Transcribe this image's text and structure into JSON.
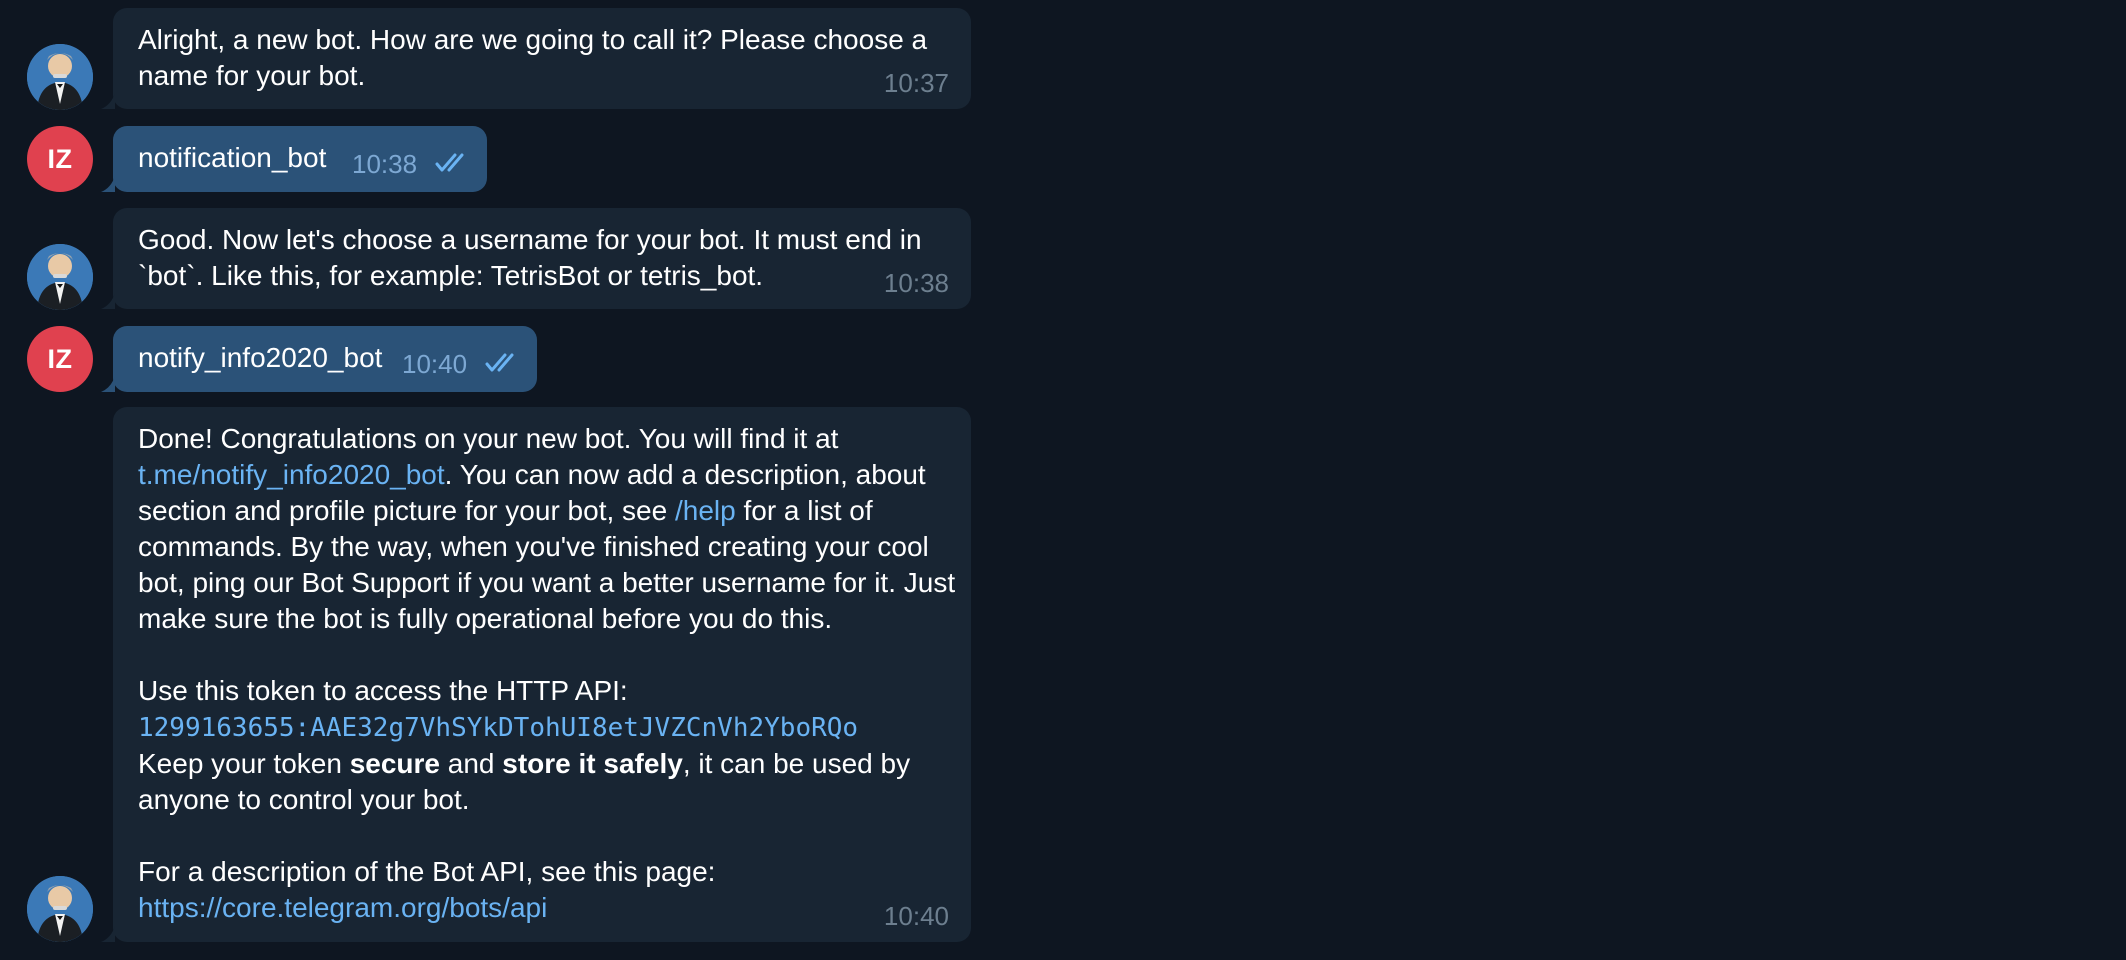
{
  "colors": {
    "background": "#0e1621",
    "incoming_bubble": "#182533",
    "outgoing_bubble": "#2b5278",
    "link": "#6ab3f3",
    "time": "#6d7f8f",
    "avatar_iz": "#e0414f"
  },
  "user": {
    "initials": "IZ"
  },
  "messages": [
    {
      "sender": "bot",
      "lines": [
        "Alright, a new bot. How are we going to call it? Please choose a",
        "name for your bot."
      ],
      "time": "10:37"
    },
    {
      "sender": "user",
      "text": "notification_bot",
      "time": "10:38",
      "read": true
    },
    {
      "sender": "bot",
      "lines": [
        "Good. Now let's choose a username for your bot. It must end in",
        "`bot`. Like this, for example: TetrisBot or tetris_bot."
      ],
      "time": "10:38"
    },
    {
      "sender": "user",
      "text": "notify_info2020_bot",
      "time": "10:40",
      "read": true
    },
    {
      "sender": "bot",
      "time": "10:40",
      "p1": {
        "l1": "Done! Congratulations on your new bot. You will find it at",
        "link1": "t.me/notify_info2020_bot",
        "l2_rest": ". You can now add a description, about",
        "l3_a": "section and profile picture for your bot, see ",
        "link2": "/help",
        "l3_b": " for a list of",
        "l4": "commands. By the way, when you've finished creating your cool",
        "l5": "bot, ping our Bot Support if you want a better username for it. Just",
        "l6": "make sure the bot is fully operational before you do this."
      },
      "p2": {
        "l1": "Use this token to access the HTTP API:",
        "token": "1299163655:AAE32g7VhSYkDTohUI8etJVZCnVh2YboRQo",
        "l3_a": "Keep your token ",
        "b1": "secure",
        "l3_b": " and ",
        "b2": "store it safely",
        "l3_c": ", it can be used by",
        "l4": "anyone to control your bot."
      },
      "p3": {
        "l1": "For a description of the Bot API, see this page:",
        "link": "https://core.telegram.org/bots/api"
      }
    }
  ]
}
